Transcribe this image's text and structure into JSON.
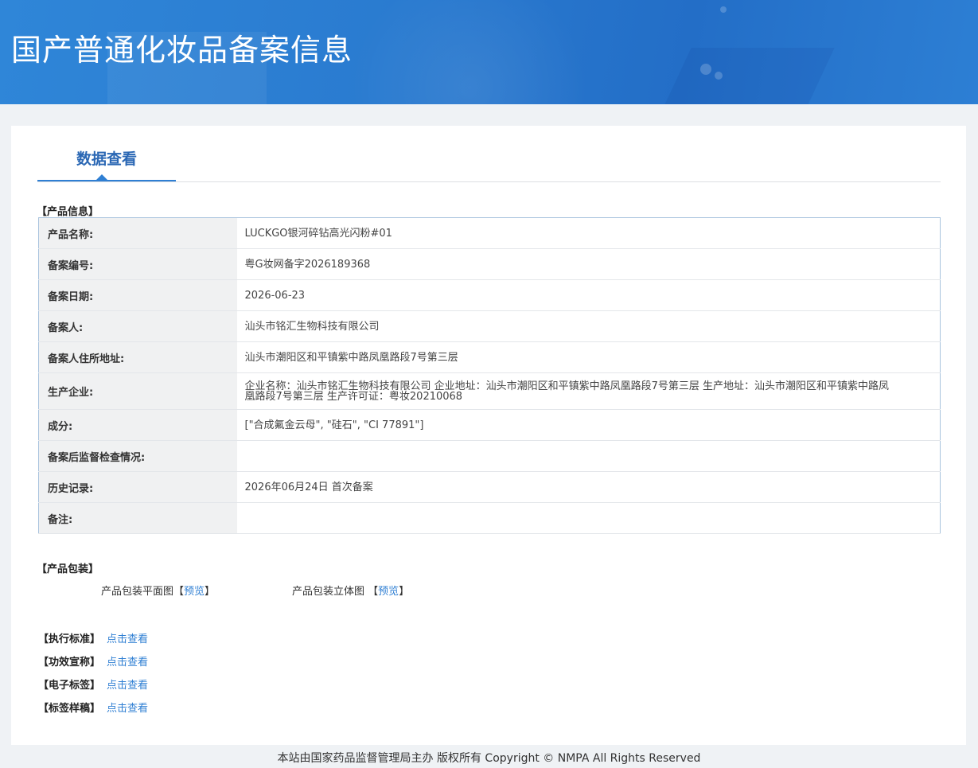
{
  "header": {
    "title": "国产普通化妆品备案信息"
  },
  "tabs": {
    "active_label": "数据查看"
  },
  "product_info": {
    "section_title": "【产品信息】",
    "rows": [
      {
        "label": "产品名称:",
        "value": "LUCKGO银河碎钻高光闪粉#01"
      },
      {
        "label": "备案编号:",
        "value": "粤G妆网备字2026189368"
      },
      {
        "label": "备案日期:",
        "value": "2026-06-23"
      },
      {
        "label": "备案人:",
        "value": "汕头市铭汇生物科技有限公司"
      },
      {
        "label": "备案人住所地址:",
        "value": "汕头市潮阳区和平镇紫中路凤凰路段7号第三层"
      },
      {
        "label": "生产企业:",
        "value": "企业名称：汕头市铭汇生物科技有限公司 企业地址：汕头市潮阳区和平镇紫中路凤凰路段7号第三层 生产地址：汕头市潮阳区和平镇紫中路凤凰路段7号第三层 生产许可证：粤妆20210068"
      },
      {
        "label": "成分:",
        "value": "[\"合成氟金云母\", \"硅石\", \"CI 77891\"]"
      },
      {
        "label": "备案后监督检查情况:",
        "value": ""
      },
      {
        "label": "历史记录:",
        "value": "2026年06月24日 首次备案"
      },
      {
        "label": "备注:",
        "value": ""
      }
    ]
  },
  "packaging": {
    "section_title": "【产品包装】",
    "flat_label": "产品包装平面图",
    "flat_bracket_open": "【",
    "flat_link": "预览",
    "flat_bracket_close": "】",
    "solid_label": "产品包装立体图",
    "solid_bracket_open": "【",
    "solid_link": "预览",
    "solid_bracket_close": "】"
  },
  "links": [
    {
      "title": "【执行标准】",
      "link": "点击查看"
    },
    {
      "title": "【功效宣称】",
      "link": "点击查看"
    },
    {
      "title": "【电子标签】",
      "link": "点击查看"
    },
    {
      "title": "【标签样稿】",
      "link": "点击查看"
    }
  ],
  "footer": {
    "text": "本站由国家药品监督管理局主办 版权所有 Copyright © NMPA All Rights Reserved"
  },
  "colors": {
    "header_blue": "#2a7bd0",
    "accent": "#2f7fd3",
    "tab_text": "#2a67b4"
  }
}
